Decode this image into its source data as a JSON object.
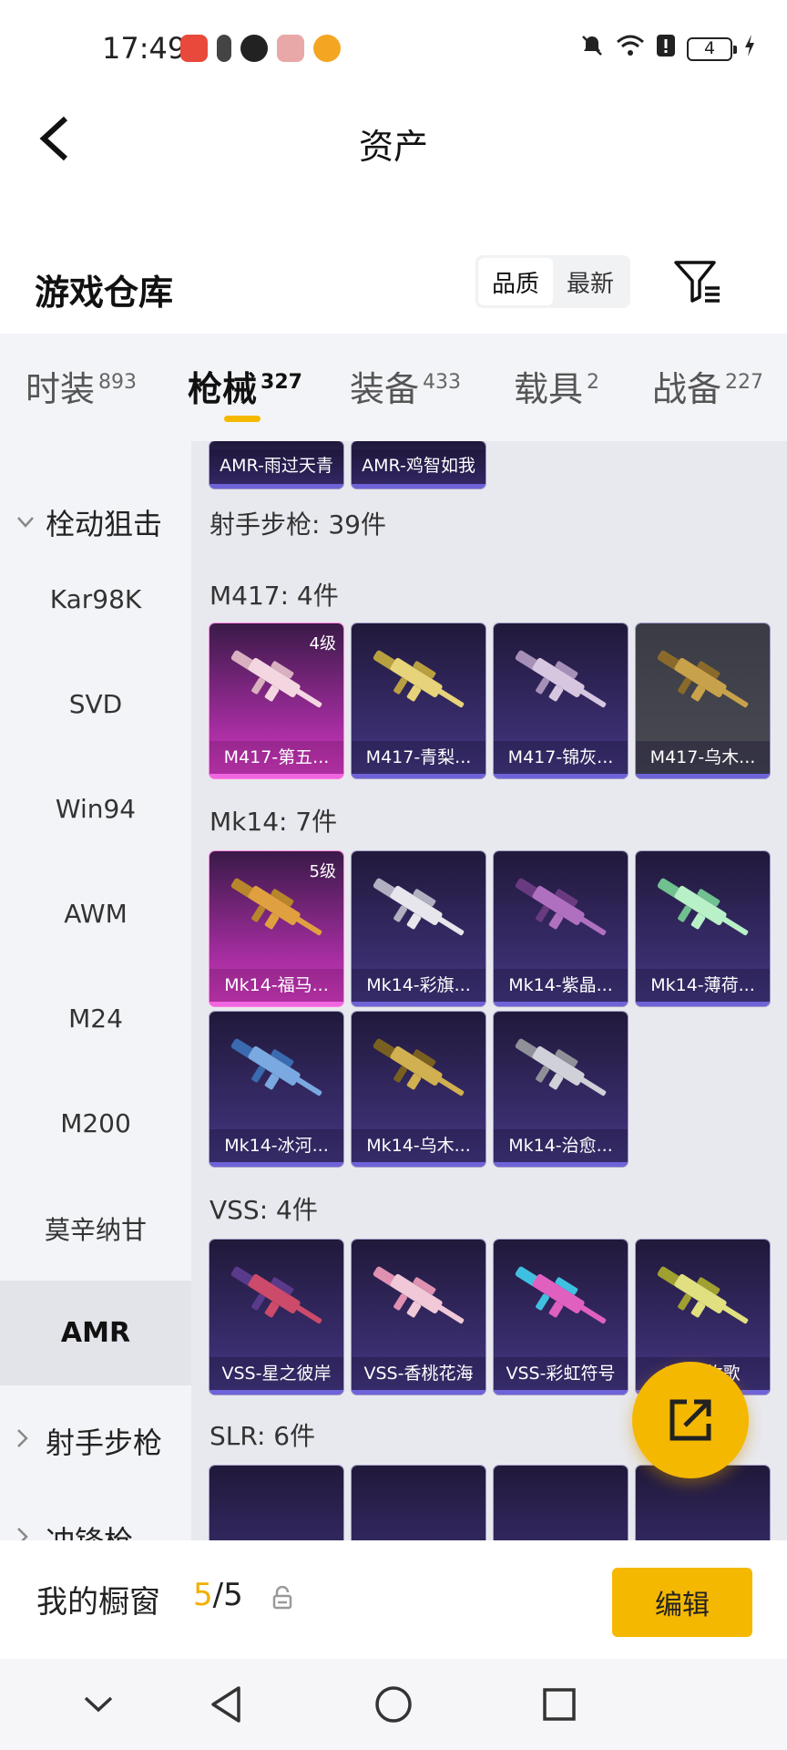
{
  "status_bar": {
    "time": "17:49",
    "battery": "4"
  },
  "header": {
    "title": "资产"
  },
  "section": {
    "title": "游戏仓库",
    "sort_options": [
      "品质",
      "最新"
    ],
    "active_sort": "品质"
  },
  "tabs": [
    {
      "label": "时装",
      "count": "893"
    },
    {
      "label": "枪械",
      "count": "327"
    },
    {
      "label": "装备",
      "count": "433"
    },
    {
      "label": "载具",
      "count": "2"
    },
    {
      "label": "战备",
      "count": "227"
    }
  ],
  "sidebar": {
    "category_top": "栓动狙击",
    "items": [
      "Kar98K",
      "SVD",
      "Win94",
      "AWM",
      "M24",
      "M200",
      "莫辛纳甘",
      "AMR"
    ],
    "active_item": "AMR",
    "category_next": "射手步枪",
    "category_partial": "冲锋枪"
  },
  "content": {
    "top_cards": [
      "AMR-雨过天青",
      "AMR-鸡智如我"
    ],
    "group_header": "射手步枪: 39件",
    "groups": [
      {
        "title": "M417: 4件",
        "cards": [
          {
            "name": "M417-第五...",
            "level": "4级",
            "rarity": "pink"
          },
          {
            "name": "M417-青梨...",
            "level": "",
            "rarity": "purple"
          },
          {
            "name": "M417-锦灰...",
            "level": "",
            "rarity": "purple"
          },
          {
            "name": "M417-乌木...",
            "level": "",
            "rarity": "gray"
          }
        ]
      },
      {
        "title": "Mk14: 7件",
        "cards": [
          {
            "name": "Mk14-福马...",
            "level": "5级",
            "rarity": "pink"
          },
          {
            "name": "Mk14-彩旗...",
            "level": "",
            "rarity": "purple"
          },
          {
            "name": "Mk14-紫晶...",
            "level": "",
            "rarity": "purple"
          },
          {
            "name": "Mk14-薄荷...",
            "level": "",
            "rarity": "purple"
          },
          {
            "name": "Mk14-冰河...",
            "level": "",
            "rarity": "purple"
          },
          {
            "name": "Mk14-乌木...",
            "level": "",
            "rarity": "purple"
          },
          {
            "name": "Mk14-治愈...",
            "level": "",
            "rarity": "purple"
          }
        ]
      },
      {
        "title": "VSS: 4件",
        "cards": [
          {
            "name": "VSS-星之彼岸",
            "level": "",
            "rarity": "purple"
          },
          {
            "name": "VSS-香桃花海",
            "level": "",
            "rarity": "purple"
          },
          {
            "name": "VSS-彩虹符号",
            "level": "",
            "rarity": "purple"
          },
          {
            "name": "VSS-牧歌",
            "level": "",
            "rarity": "purple",
            "visible_text": "牧歌"
          }
        ]
      },
      {
        "title": "SLR: 6件",
        "cards": []
      }
    ]
  },
  "bottom": {
    "showcase_label": "我的橱窗",
    "showcase_used": "5",
    "showcase_total": "/5",
    "edit_label": "编辑"
  },
  "colors": {
    "accent": "#f5b800",
    "rare_purple": "#6f63d9",
    "rare_pink": "#f066e0"
  },
  "icons": [
    "back-arrow-icon",
    "filter-icon",
    "share-export-icon",
    "lock-icon",
    "nav-back-icon",
    "nav-home-icon",
    "nav-recent-icon"
  ]
}
